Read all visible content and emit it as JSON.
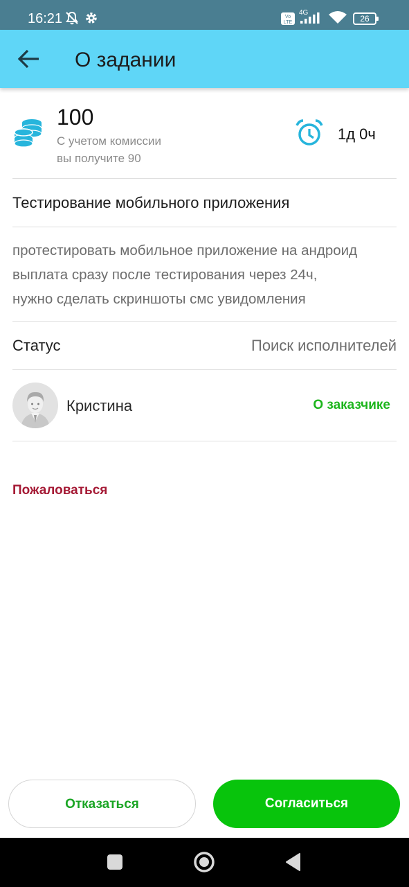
{
  "status_bar": {
    "time": "16:21",
    "network": "4G",
    "volte": "Vo LTE",
    "battery": "26"
  },
  "app_bar": {
    "title": "О задании"
  },
  "task": {
    "price": "100",
    "commission_line1": "С учетом комиссии",
    "commission_line2": "вы получите 90",
    "time_left": "1д 0ч",
    "title": "Тестирование мобильного приложения",
    "description_lines": [
      "протестировать мобильное приложение на андроид",
      "выплата сразу после тестирования через 24ч,",
      "нужно сделать скриншоты смс увидомления"
    ],
    "status_label": "Статус",
    "status_value": "Поиск исполнителей"
  },
  "customer": {
    "name": "Кристина",
    "link": "О заказчике"
  },
  "report_link": "Пожаловаться",
  "buttons": {
    "decline": "Отказаться",
    "accept": "Согласиться"
  },
  "icons": {
    "back": "arrow-left-icon",
    "coins": "coins-stack-icon",
    "timer": "alarm-clock-icon",
    "avatar": "user-avatar-icon"
  },
  "colors": {
    "app_bar": "#5fd6f7",
    "accent_icon": "#27b5dc",
    "link_green": "#1cb51c",
    "accept_green": "#08c40c",
    "report_red": "#a51a35"
  }
}
